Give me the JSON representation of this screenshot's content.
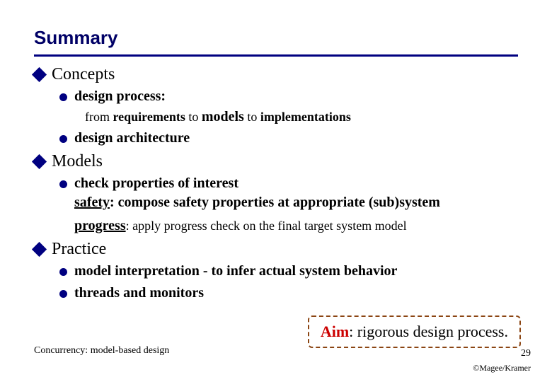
{
  "title": "Summary",
  "sections": {
    "concepts": {
      "label": "Concepts",
      "b1": "design process:",
      "b1sub_from": "from ",
      "b1sub_req": "requirements",
      "b1sub_to1": " to ",
      "b1sub_models": "models",
      "b1sub_to2": " to ",
      "b1sub_impl": "implementations",
      "b2": "design architecture"
    },
    "models": {
      "label": "Models",
      "b1": "check properties of interest",
      "safety_label": "safety",
      "safety_text": ": compose safety properties at appropriate (sub)system",
      "progress_label": "progress",
      "progress_text": ": apply progress check on the final target system model"
    },
    "practice": {
      "label": "Practice",
      "b1": "model interpretation - to infer actual system behavior",
      "b2": "threads and monitors"
    }
  },
  "aim": {
    "label": "Aim",
    "text": ": rigorous design process."
  },
  "footer": {
    "left": "Concurrency: model-based design",
    "page": "29",
    "copyright": "©Magee/Kramer"
  }
}
